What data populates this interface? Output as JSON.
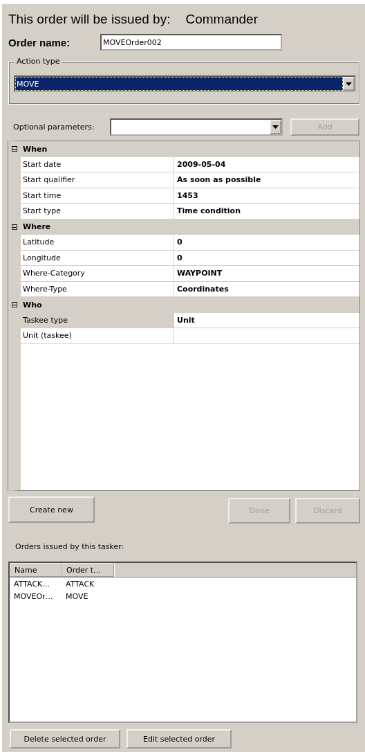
{
  "header": {
    "label": "This order will be issued by:",
    "issuer": "Commander"
  },
  "order_name": {
    "label": "Order name:",
    "value": "MOVEOrder002"
  },
  "action_type": {
    "legend": "Action type",
    "value": "MOVE",
    "focused": true
  },
  "optional_parameters": {
    "label": "Optional parameters:",
    "add_button": {
      "label": "Add",
      "disabled": true
    }
  },
  "property_grid": {
    "categories": [
      {
        "label": "When",
        "expanded": true,
        "expander": "⊟",
        "properties": [
          {
            "name": "Start date",
            "value": "2009-05-04",
            "selected": false
          },
          {
            "name": "Start qualifier",
            "value": "As soon as possible",
            "selected": false
          },
          {
            "name": "Start time",
            "value": "1453",
            "selected": false
          },
          {
            "name": "Start type",
            "value": "Time condition",
            "selected": false
          }
        ]
      },
      {
        "label": "Where",
        "expanded": true,
        "expander": "⊟",
        "properties": [
          {
            "name": "Latitude",
            "value": "0",
            "selected": false
          },
          {
            "name": "Longitude",
            "value": "0",
            "selected": false
          },
          {
            "name": "Where-Category",
            "value": "WAYPOINT",
            "selected": false
          },
          {
            "name": "Where-Type",
            "value": "Coordinates",
            "selected": false
          }
        ]
      },
      {
        "label": "Who",
        "expanded": true,
        "expander": "⊟",
        "properties": [
          {
            "name": "Taskee type",
            "value": "Unit",
            "selected": true
          },
          {
            "name": "Unit (taskee)",
            "selected": false
          }
        ]
      }
    ]
  },
  "action_buttons": [
    {
      "label": "Create new",
      "disabled": false
    },
    {
      "label": "Done",
      "disabled": true
    },
    {
      "label": "Discard",
      "disabled": true
    }
  ],
  "orders": {
    "label": "Orders issued by this tasker:",
    "columns": [
      "Name",
      "Order t…"
    ],
    "rows": [
      {
        "cells": [
          "ATTACK…",
          "ATTACK"
        ],
        "selected": false
      },
      {
        "cells": [
          "MOVEOr…",
          "MOVE"
        ],
        "selected": false
      }
    ]
  },
  "bottom_buttons": [
    {
      "label": "Delete selected order",
      "disabled": false
    },
    {
      "label": "Edit selected order",
      "disabled": false
    }
  ]
}
